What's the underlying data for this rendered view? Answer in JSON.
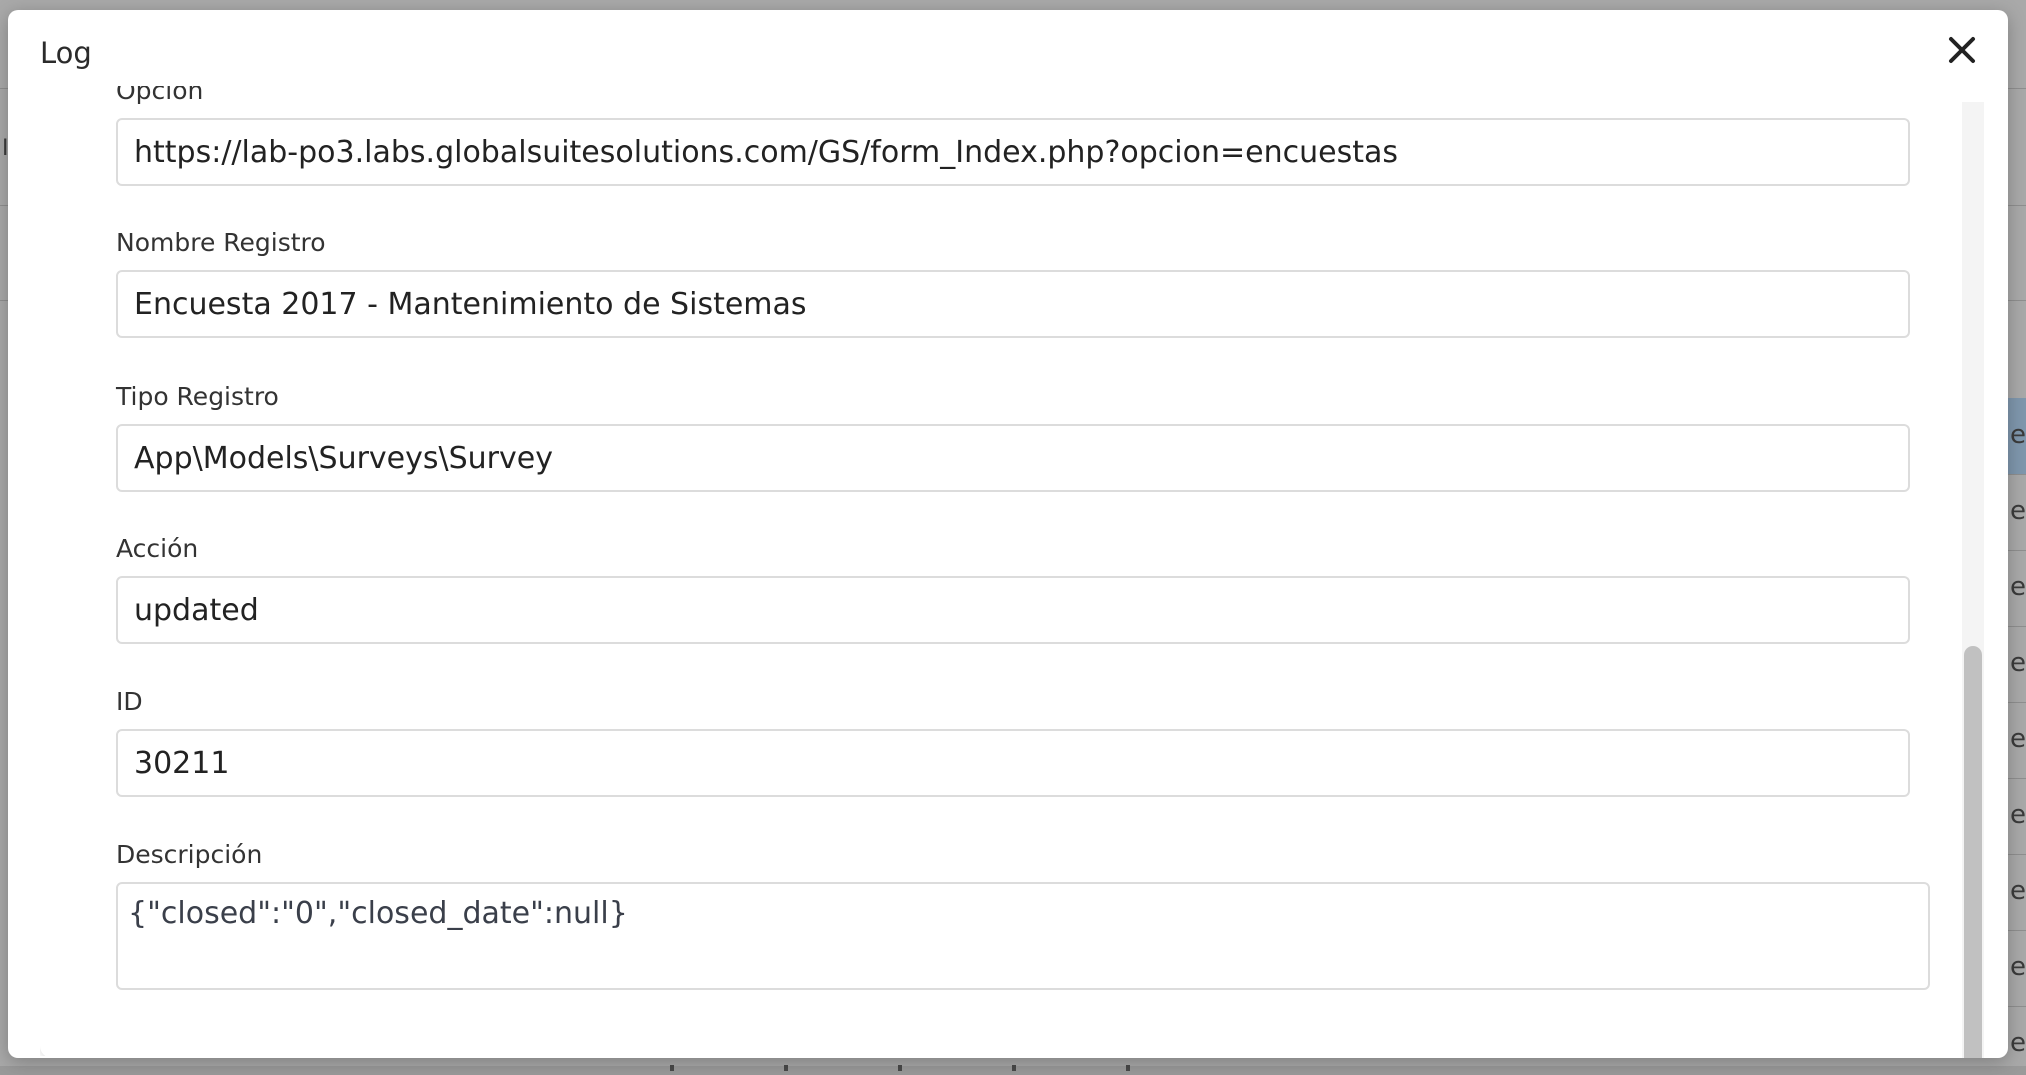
{
  "modal": {
    "title": "Log",
    "close_icon": "close-icon"
  },
  "fields": {
    "opcion": {
      "label": "Opción",
      "value": "https://lab-po3.labs.globalsuitesolutions.com/GS/form_Index.php?opcion=encuestas"
    },
    "nombre_registro": {
      "label": "Nombre Registro",
      "value": "Encuesta 2017 - Mantenimiento de Sistemas"
    },
    "tipo_registro": {
      "label": "Tipo Registro",
      "value": "App\\Models\\Surveys\\Survey"
    },
    "accion": {
      "label": "Acción",
      "value": "updated"
    },
    "id": {
      "label": "ID",
      "value": "30211"
    },
    "descripcion": {
      "label": "Descripción",
      "value": "{\"closed\":\"0\",\"closed_date\":null}"
    }
  },
  "background": {
    "left_edge_text": "I",
    "right_edge_text": "e"
  },
  "colors": {
    "overlay": "#a9a9a9",
    "modal_bg": "#ffffff",
    "field_border": "#dcdcdc",
    "scrollbar_thumb": "#c1c1c1"
  }
}
